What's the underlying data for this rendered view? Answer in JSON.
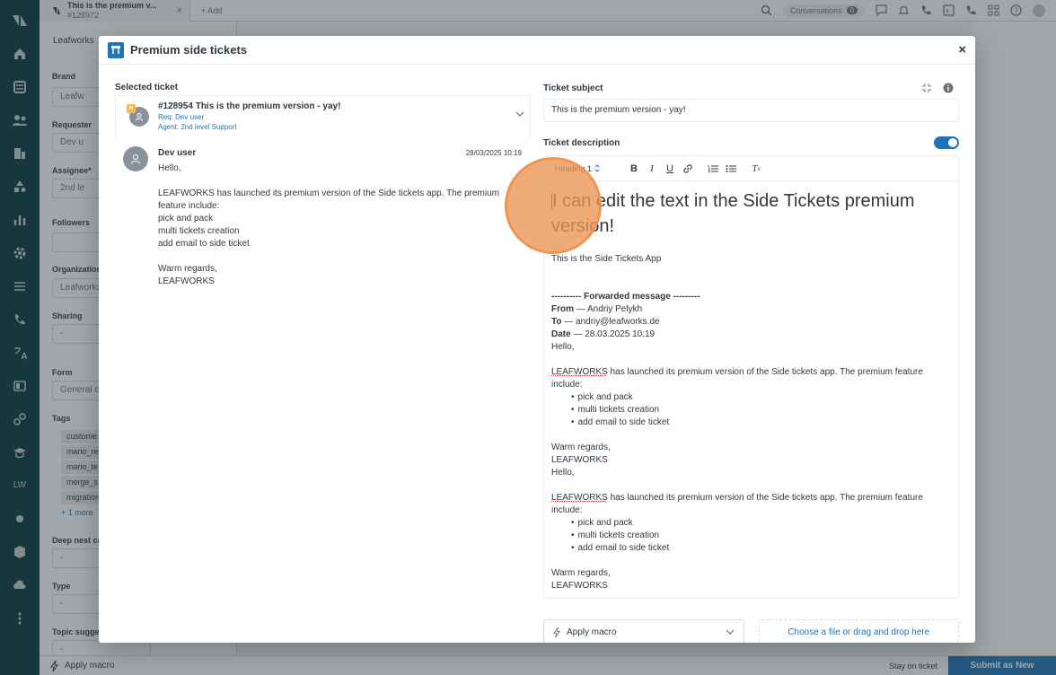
{
  "top_tabs": {
    "tab_title": "This is the premium v...",
    "tab_id": "#128972",
    "add_label": "+ Add",
    "conversations_label": "Conversations",
    "conversations_count": "0"
  },
  "background": {
    "tab_label": "Leafworks",
    "brand_label": "Brand",
    "brand_value": "Leafw",
    "requester_label": "Requester",
    "requester_value": "Dev u",
    "assignee_label": "Assignee*",
    "assignee_value": "2nd le",
    "followers_label": "Followers",
    "organization_label": "Organization",
    "organization_value": "Leafworks",
    "sharing_label": "Sharing",
    "sharing_value": "-",
    "form_label": "Form",
    "form_value": "General c",
    "tags_label": "Tags",
    "tags": [
      "custome",
      "mario_re",
      "mario_te",
      "merge_s",
      "migration"
    ],
    "more_tags": "+ 1 more",
    "deep_nest_label": "Deep nest ca",
    "deep_nest_value": "-",
    "type_label": "Type",
    "type_value": "-",
    "topic_label": "Topic sugge",
    "topic_value": "-",
    "left_nav_text": "LW"
  },
  "bottombar": {
    "macro_label": "Apply macro",
    "stay_label": "Stay on ticket",
    "submit_label": "Submit as New"
  },
  "modal": {
    "title": "Premium side tickets",
    "selected_ticket_label": "Selected ticket",
    "selected_ticket": {
      "badge": "N",
      "title": "#128954 This is the premium version - yay!",
      "requester": "Req: Dev user",
      "agent": "Agent: 2nd level Support"
    },
    "message": {
      "sender": "Dev user",
      "time": "28/03/2025 10:19",
      "greeting": "Hello,",
      "para": "LEAFWORKS has launched its premium version of the Side tickets app. The premium feature include:",
      "items": [
        "pick and pack",
        "multi tickets creation",
        "add email to side ticket"
      ],
      "closing": "Warm regards,",
      "signature": "LEAFWORKS"
    },
    "subject_label": "Ticket subject",
    "subject_value": "This is the premium version - yay!",
    "description_label": "Ticket description",
    "heading_select": "Heading 1",
    "editor": {
      "heading": "I can edit the text in the Side Tickets premium version!",
      "hi": "Hi,",
      "intro": "This is the Side Tickets App",
      "fwd": "---------- Forwarded message ---------",
      "from_label": "From",
      "from_value": "— Andriy Pelykh",
      "to_label": "To",
      "to_value": "— andriy@leafworks.de",
      "date_label": "Date",
      "date_value": "— 28.03.2025 10:19",
      "hello": "Hello,",
      "brand": "LEAFWORKS",
      "para_rest": " has launched its premium version of the Side tickets app. The premium feature include:",
      "items": [
        "pick and pack",
        "multi tickets creation",
        "add email to side ticket"
      ],
      "closing": "Warm regards,",
      "signature": "LEAFWORKS"
    },
    "apply_macro_label": "Apply macro",
    "upload_label": "Choose a file or drag and drop here"
  }
}
